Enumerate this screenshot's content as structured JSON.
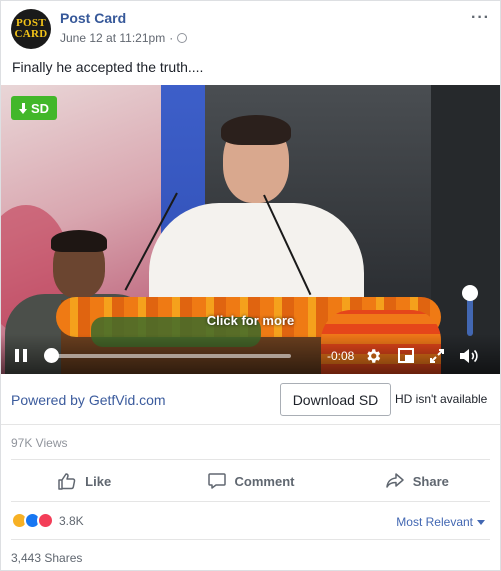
{
  "post": {
    "page_name": "Post Card",
    "logo_text": [
      "POST",
      "CARD"
    ],
    "timestamp": "June 12 at 11:21pm",
    "separator": "·",
    "privacy_icon": "globe-icon",
    "more_options": "···",
    "caption": "Finally he accepted the truth...."
  },
  "video": {
    "quality_badge": "SD",
    "overlay_text": "Click for more",
    "time_remaining": "-0:08",
    "progress_fraction": 0.02,
    "volume_fraction": 1.0,
    "icons": [
      "pause-icon",
      "settings-gear-icon",
      "picture-in-picture-icon",
      "fullscreen-icon",
      "volume-icon",
      "download-arrow-icon"
    ]
  },
  "getfvid": {
    "powered_by": "Powered by GetfVid.com",
    "download_label": "Download SD",
    "hd_status": "HD isn't available"
  },
  "stats": {
    "views": "97K Views",
    "reaction_count": "3.8K",
    "shares": "3,443 Shares",
    "sort_label": "Most Relevant"
  },
  "actions": {
    "like": "Like",
    "comment": "Comment",
    "share": "Share"
  },
  "colors": {
    "link_blue": "#365899",
    "badge_green": "#42b72a",
    "accent_blue": "#4267b2",
    "muted_text": "#606770"
  }
}
